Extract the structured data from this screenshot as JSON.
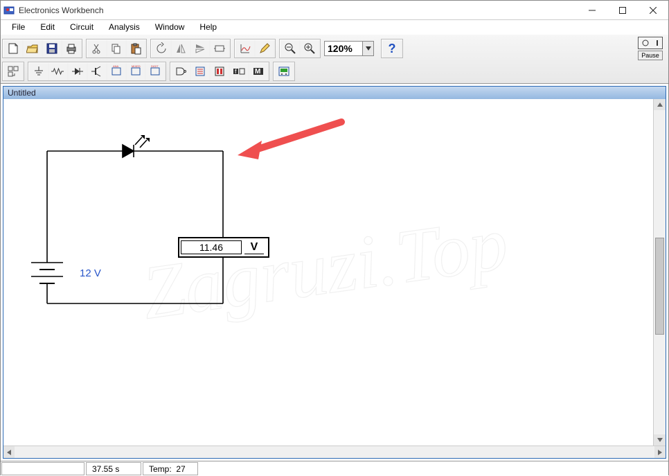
{
  "window": {
    "title": "Electronics Workbench"
  },
  "menu": {
    "items": [
      "File",
      "Edit",
      "Circuit",
      "Analysis",
      "Window",
      "Help"
    ]
  },
  "toolbar": {
    "zoom": "120%",
    "pause_label": "Pause"
  },
  "document": {
    "title": "Untitled"
  },
  "circuit": {
    "battery_label": "12 V",
    "voltmeter_reading": "11.46",
    "voltmeter_unit": "V"
  },
  "status": {
    "time": "37.55 s",
    "temp_label": "Temp:",
    "temp_value": "27"
  },
  "watermark": "Zagruzi.Top"
}
